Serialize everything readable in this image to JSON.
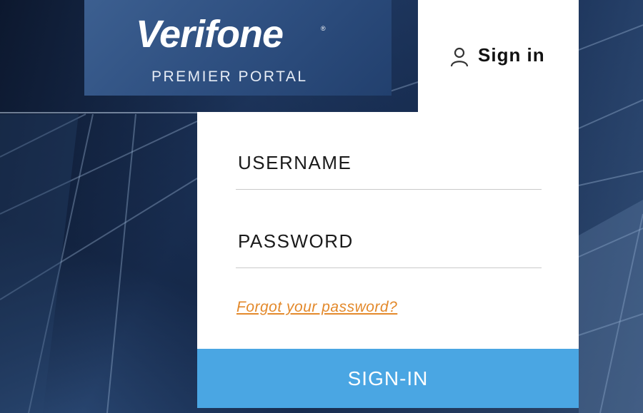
{
  "brand": {
    "name": "Verifone",
    "registered_mark": "®",
    "subtitle": "PREMIER PORTAL"
  },
  "signin_tab": {
    "icon": "user-icon",
    "label": "Sign in"
  },
  "form": {
    "username_label": "USERNAME",
    "username_value": "",
    "password_label": "PASSWORD",
    "password_value": "",
    "forgot_link": "Forgot your password?",
    "submit_label": "SIGN-IN"
  },
  "colors": {
    "link": "#e3892b",
    "submit_bg": "#4aa6e3",
    "background": "#12233f"
  }
}
